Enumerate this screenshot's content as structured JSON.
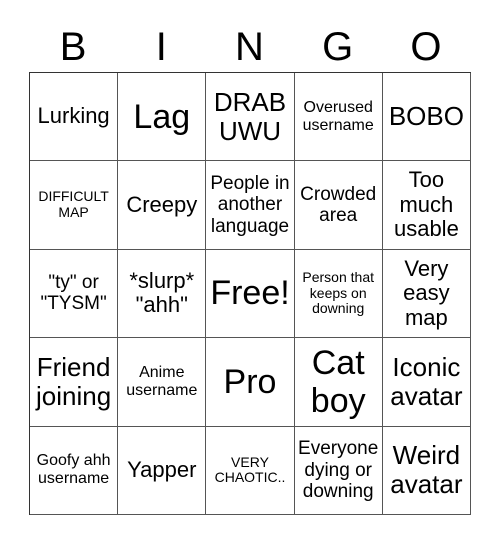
{
  "header": {
    "letters": [
      "B",
      "I",
      "N",
      "G",
      "O"
    ]
  },
  "grid": {
    "rows": [
      [
        {
          "text": "Lurking",
          "size": "s-lg"
        },
        {
          "text": "Lag",
          "size": "s-xxl"
        },
        {
          "text": "DRAB UWU",
          "size": "s-xl"
        },
        {
          "text": "Overused username",
          "size": "s-sm"
        },
        {
          "text": "BOBO",
          "size": "s-xl"
        }
      ],
      [
        {
          "text": "DIFFICULT MAP",
          "size": "s-xs"
        },
        {
          "text": "Creepy",
          "size": "s-lg"
        },
        {
          "text": "People in another language",
          "size": "s-md"
        },
        {
          "text": "Crowded area",
          "size": "s-md"
        },
        {
          "text": "Too much usable",
          "size": "s-lg"
        }
      ],
      [
        {
          "text": "\"ty\" or \"TYSM\"",
          "size": "s-md"
        },
        {
          "text": "*slurp* \"ahh\"",
          "size": "s-lg"
        },
        {
          "text": "Free!",
          "size": "s-xxl"
        },
        {
          "text": "Person that keeps on downing",
          "size": "s-xs"
        },
        {
          "text": "Very easy map",
          "size": "s-lg"
        }
      ],
      [
        {
          "text": "Friend joining",
          "size": "s-xl"
        },
        {
          "text": "Anime username",
          "size": "s-sm"
        },
        {
          "text": "Pro",
          "size": "s-xxl"
        },
        {
          "text": "Cat boy",
          "size": "s-xxl"
        },
        {
          "text": "Iconic avatar",
          "size": "s-xl"
        }
      ],
      [
        {
          "text": "Goofy ahh username",
          "size": "s-sm"
        },
        {
          "text": "Yapper",
          "size": "s-lg"
        },
        {
          "text": "VERY CHAOTIC..",
          "size": "s-xs"
        },
        {
          "text": "Everyone dying or downing",
          "size": "s-md"
        },
        {
          "text": "Weird avatar",
          "size": "s-xl"
        }
      ]
    ]
  }
}
